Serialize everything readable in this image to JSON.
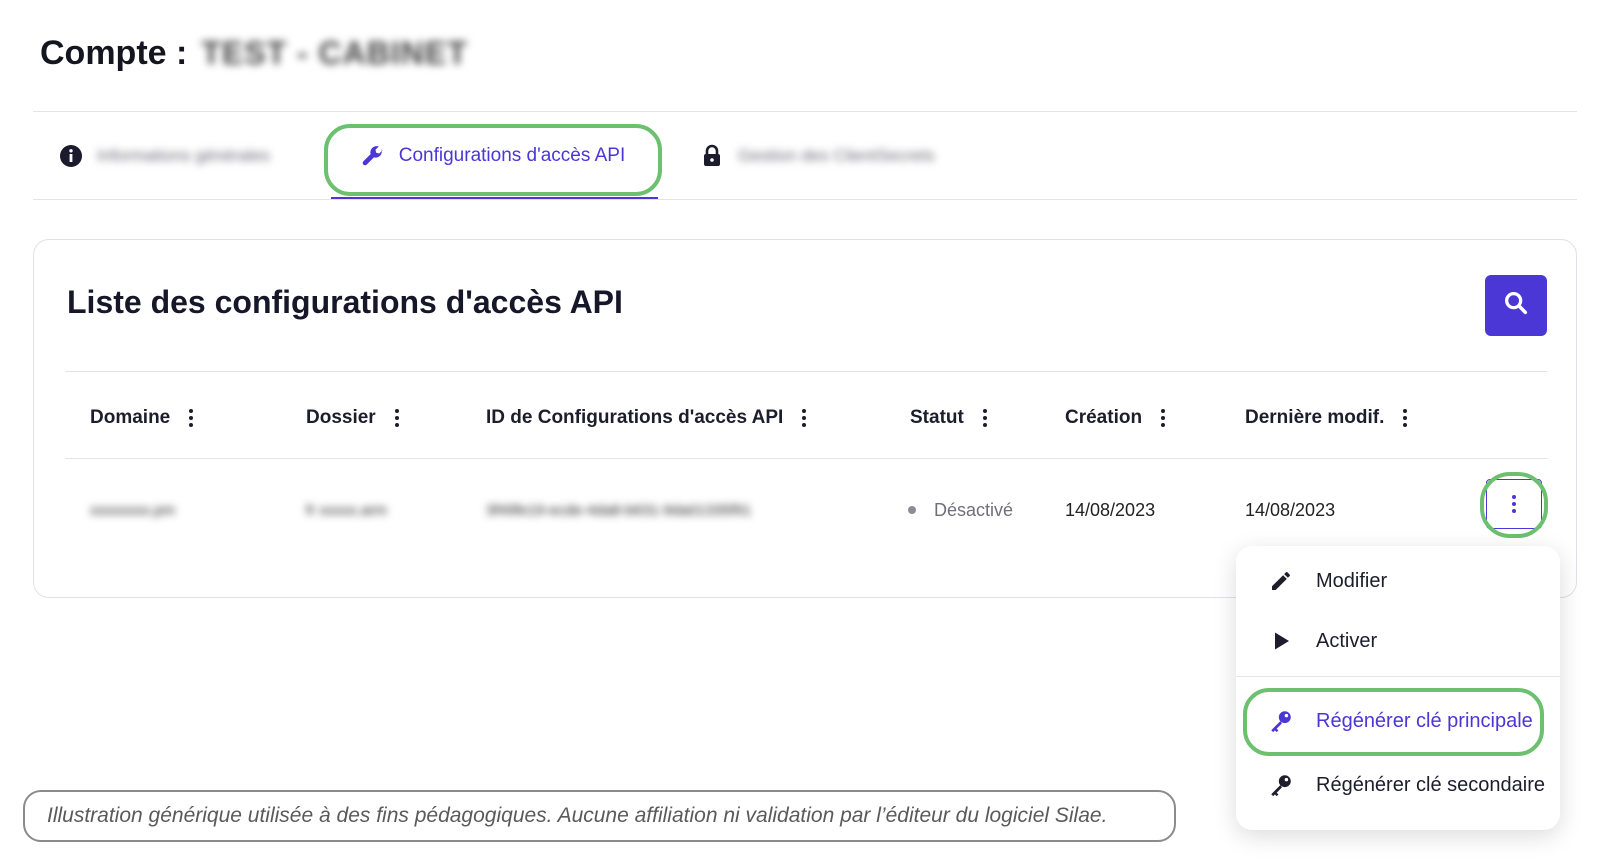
{
  "header": {
    "title": "Compte :",
    "account_name": "TEST - CABINET"
  },
  "tabs": [
    {
      "label": "Informations générales",
      "icon": "info-icon",
      "active": false
    },
    {
      "label": "Configurations d'accès API",
      "icon": "wrench-icon",
      "active": true
    },
    {
      "label": "Gestion des ClientSecrets",
      "icon": "lock-icon",
      "active": false
    }
  ],
  "card": {
    "title": "Liste des configurations d'accès API",
    "search_icon": "search-icon"
  },
  "table": {
    "columns": [
      "Domaine",
      "Dossier",
      "ID de Configurations d'accès API",
      "Statut",
      "Création",
      "Dernière modif."
    ],
    "rows": [
      {
        "domaine": "xxxxxxxx.pm",
        "dossier": "fr xxxxx.arm",
        "id": "3f49fe19-ecde-4da8-b631-9da01335f91",
        "statut": "Désactivé",
        "creation": "14/08/2023",
        "derniere_modif": "14/08/2023"
      }
    ]
  },
  "menu": {
    "items": [
      {
        "label": "Modifier",
        "icon": "pencil-icon"
      },
      {
        "label": "Activer",
        "icon": "play-icon"
      },
      {
        "label": "Régénérer clé principale",
        "icon": "key-icon"
      },
      {
        "label": "Régénérer clé secondaire",
        "icon": "key-icon"
      }
    ]
  },
  "disclaimer": "Illustration générique utilisée à des fins pédagogiques. Aucune affiliation ni validation par l’éditeur du logiciel Silae.",
  "colors": {
    "accent": "#4a37d6",
    "highlight": "#6cc06f",
    "status_inactive": "#8c8c98"
  }
}
